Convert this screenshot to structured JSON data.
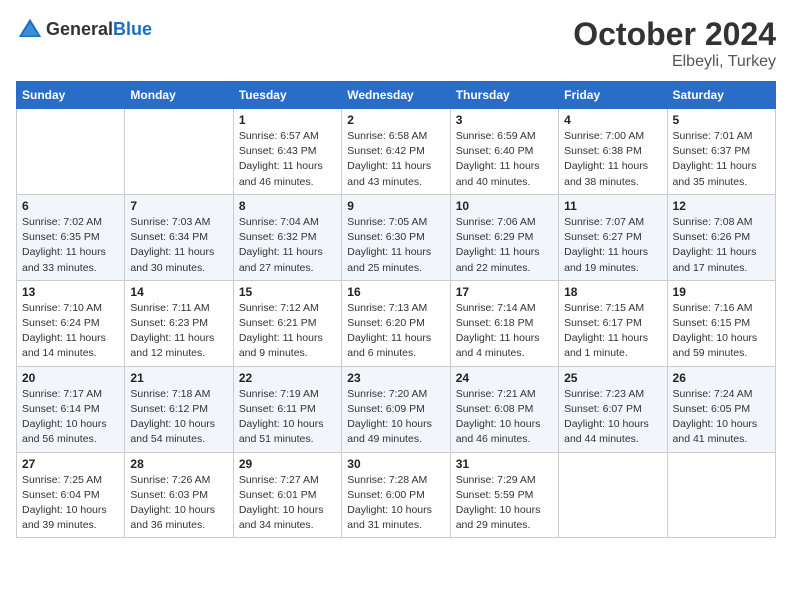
{
  "header": {
    "logo_line1": "General",
    "logo_line2": "Blue",
    "month": "October 2024",
    "location": "Elbeyli, Turkey"
  },
  "weekdays": [
    "Sunday",
    "Monday",
    "Tuesday",
    "Wednesday",
    "Thursday",
    "Friday",
    "Saturday"
  ],
  "weeks": [
    [
      {
        "day": null
      },
      {
        "day": null
      },
      {
        "day": "1",
        "sunrise": "6:57 AM",
        "sunset": "6:43 PM",
        "daylight": "11 hours and 46 minutes."
      },
      {
        "day": "2",
        "sunrise": "6:58 AM",
        "sunset": "6:42 PM",
        "daylight": "11 hours and 43 minutes."
      },
      {
        "day": "3",
        "sunrise": "6:59 AM",
        "sunset": "6:40 PM",
        "daylight": "11 hours and 40 minutes."
      },
      {
        "day": "4",
        "sunrise": "7:00 AM",
        "sunset": "6:38 PM",
        "daylight": "11 hours and 38 minutes."
      },
      {
        "day": "5",
        "sunrise": "7:01 AM",
        "sunset": "6:37 PM",
        "daylight": "11 hours and 35 minutes."
      }
    ],
    [
      {
        "day": "6",
        "sunrise": "7:02 AM",
        "sunset": "6:35 PM",
        "daylight": "11 hours and 33 minutes."
      },
      {
        "day": "7",
        "sunrise": "7:03 AM",
        "sunset": "6:34 PM",
        "daylight": "11 hours and 30 minutes."
      },
      {
        "day": "8",
        "sunrise": "7:04 AM",
        "sunset": "6:32 PM",
        "daylight": "11 hours and 27 minutes."
      },
      {
        "day": "9",
        "sunrise": "7:05 AM",
        "sunset": "6:30 PM",
        "daylight": "11 hours and 25 minutes."
      },
      {
        "day": "10",
        "sunrise": "7:06 AM",
        "sunset": "6:29 PM",
        "daylight": "11 hours and 22 minutes."
      },
      {
        "day": "11",
        "sunrise": "7:07 AM",
        "sunset": "6:27 PM",
        "daylight": "11 hours and 19 minutes."
      },
      {
        "day": "12",
        "sunrise": "7:08 AM",
        "sunset": "6:26 PM",
        "daylight": "11 hours and 17 minutes."
      }
    ],
    [
      {
        "day": "13",
        "sunrise": "7:10 AM",
        "sunset": "6:24 PM",
        "daylight": "11 hours and 14 minutes."
      },
      {
        "day": "14",
        "sunrise": "7:11 AM",
        "sunset": "6:23 PM",
        "daylight": "11 hours and 12 minutes."
      },
      {
        "day": "15",
        "sunrise": "7:12 AM",
        "sunset": "6:21 PM",
        "daylight": "11 hours and 9 minutes."
      },
      {
        "day": "16",
        "sunrise": "7:13 AM",
        "sunset": "6:20 PM",
        "daylight": "11 hours and 6 minutes."
      },
      {
        "day": "17",
        "sunrise": "7:14 AM",
        "sunset": "6:18 PM",
        "daylight": "11 hours and 4 minutes."
      },
      {
        "day": "18",
        "sunrise": "7:15 AM",
        "sunset": "6:17 PM",
        "daylight": "11 hours and 1 minute."
      },
      {
        "day": "19",
        "sunrise": "7:16 AM",
        "sunset": "6:15 PM",
        "daylight": "10 hours and 59 minutes."
      }
    ],
    [
      {
        "day": "20",
        "sunrise": "7:17 AM",
        "sunset": "6:14 PM",
        "daylight": "10 hours and 56 minutes."
      },
      {
        "day": "21",
        "sunrise": "7:18 AM",
        "sunset": "6:12 PM",
        "daylight": "10 hours and 54 minutes."
      },
      {
        "day": "22",
        "sunrise": "7:19 AM",
        "sunset": "6:11 PM",
        "daylight": "10 hours and 51 minutes."
      },
      {
        "day": "23",
        "sunrise": "7:20 AM",
        "sunset": "6:09 PM",
        "daylight": "10 hours and 49 minutes."
      },
      {
        "day": "24",
        "sunrise": "7:21 AM",
        "sunset": "6:08 PM",
        "daylight": "10 hours and 46 minutes."
      },
      {
        "day": "25",
        "sunrise": "7:23 AM",
        "sunset": "6:07 PM",
        "daylight": "10 hours and 44 minutes."
      },
      {
        "day": "26",
        "sunrise": "7:24 AM",
        "sunset": "6:05 PM",
        "daylight": "10 hours and 41 minutes."
      }
    ],
    [
      {
        "day": "27",
        "sunrise": "7:25 AM",
        "sunset": "6:04 PM",
        "daylight": "10 hours and 39 minutes."
      },
      {
        "day": "28",
        "sunrise": "7:26 AM",
        "sunset": "6:03 PM",
        "daylight": "10 hours and 36 minutes."
      },
      {
        "day": "29",
        "sunrise": "7:27 AM",
        "sunset": "6:01 PM",
        "daylight": "10 hours and 34 minutes."
      },
      {
        "day": "30",
        "sunrise": "7:28 AM",
        "sunset": "6:00 PM",
        "daylight": "10 hours and 31 minutes."
      },
      {
        "day": "31",
        "sunrise": "7:29 AM",
        "sunset": "5:59 PM",
        "daylight": "10 hours and 29 minutes."
      },
      {
        "day": null
      },
      {
        "day": null
      }
    ]
  ]
}
